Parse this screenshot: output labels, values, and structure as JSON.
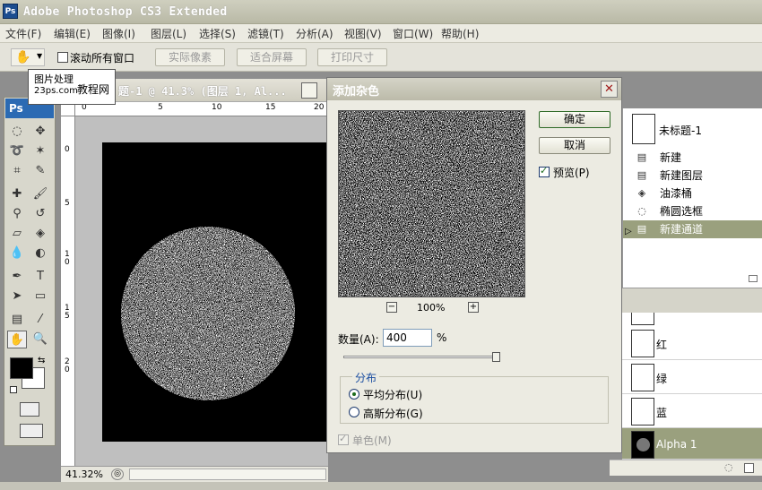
{
  "app": {
    "title": "Adobe Photoshop CS3 Extended",
    "logo": "Ps"
  },
  "menu": [
    "文件(F)",
    "编辑(E)",
    "图像(I)",
    "图层(L)",
    "选择(S)",
    "滤镜(T)",
    "分析(A)",
    "视图(V)",
    "窗口(W)",
    "帮助(H)"
  ],
  "options": {
    "scroll_all_label": "滚动所有窗口",
    "actual_pixels": "实际像素",
    "fit_screen": "适合屏幕",
    "print_size": "打印尺寸"
  },
  "tooltip": {
    "line1": "图片处理",
    "line2": "23ps.com",
    "line3": "教程网"
  },
  "toolbox": {
    "head": "Ps"
  },
  "document": {
    "title": "题-1 @ 41.3% (图层 1, Al...",
    "zoom": "41.32%",
    "ruler_h": [
      "0",
      "5",
      "10",
      "15",
      "20"
    ],
    "ruler_v": [
      "0",
      "5",
      "1\n0",
      "1\n5",
      "2\n0"
    ]
  },
  "dialog": {
    "title": "添加杂色",
    "ok": "确定",
    "cancel": "取消",
    "preview_label": "预览(P)",
    "preview_checked": true,
    "zoom_minus": "−",
    "zoom_plus": "+",
    "zoom_level": "100%",
    "amount_label": "数量(A):",
    "amount_value": "400",
    "amount_unit": "%",
    "amount_slider_fraction": 0.97,
    "distribution_label": "分布",
    "uniform_label": "平均分布(U)",
    "gaussian_label": "高斯分布(G)",
    "uniform_selected": true,
    "monochrome_label": "单色(M)",
    "monochrome_checked": true
  },
  "history": {
    "snapshot_label": "未标题-1",
    "items": [
      {
        "label": "新建",
        "icon": "history-state-icon"
      },
      {
        "label": "新建图层",
        "icon": "history-state-icon"
      },
      {
        "label": "油漆桶",
        "icon": "paint-bucket-icon"
      },
      {
        "label": "椭圆选框",
        "icon": "ellipse-marquee-icon"
      },
      {
        "label": "新建通道",
        "icon": "history-state-icon",
        "selected": true
      }
    ]
  },
  "channels": {
    "items": [
      {
        "label": "红"
      },
      {
        "label": "绿"
      },
      {
        "label": "蓝"
      },
      {
        "label": "Alpha 1",
        "selected": true
      }
    ]
  },
  "colors": {
    "selected_row": "#9aa07e",
    "dialog_bg": "#ecebe2",
    "ps_blue": "#2b6ab3"
  }
}
